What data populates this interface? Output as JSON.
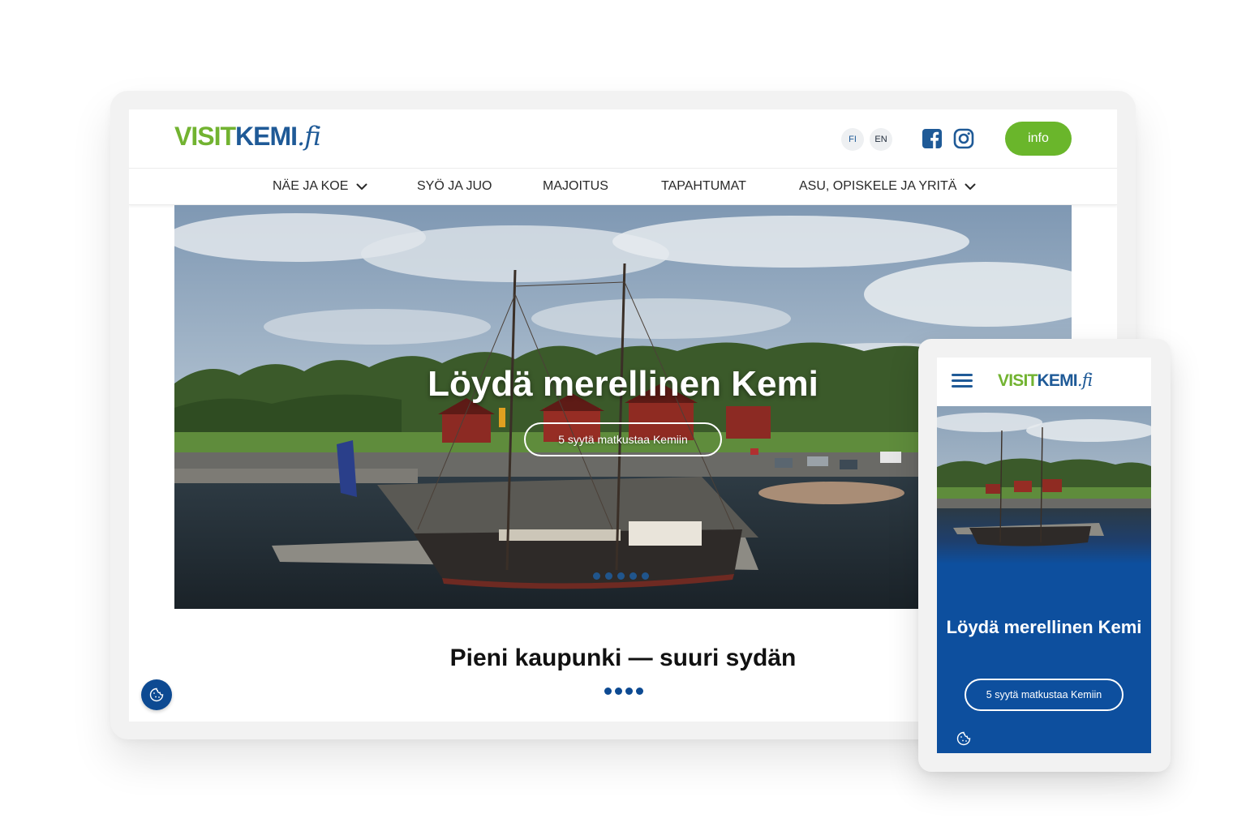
{
  "brand": {
    "logo_visit": "VISIT",
    "logo_kemi": "KEMI",
    "logo_tld": ".fi",
    "green": "#6ab62b",
    "blue": "#1f5a97",
    "dark_blue": "#0d4a92"
  },
  "header": {
    "lang_fi": "FI",
    "lang_en": "EN",
    "facebook_icon": "facebook-icon",
    "instagram_icon": "instagram-icon",
    "info_label": "info"
  },
  "nav": {
    "items": [
      {
        "label": "NÄE JA KOE",
        "has_dropdown": true
      },
      {
        "label": "SYÖ JA JUO",
        "has_dropdown": false
      },
      {
        "label": "MAJOITUS",
        "has_dropdown": false
      },
      {
        "label": "TAPAHTUMAT",
        "has_dropdown": false
      },
      {
        "label": "ASU, OPISKELE JA YRITÄ",
        "has_dropdown": true
      }
    ]
  },
  "hero": {
    "title": "Löydä merellinen Kemi",
    "cta_label": "5 syytä matkustaa Kemiin",
    "slide_count": 5
  },
  "section": {
    "title": "Pieni kaupunki — suuri sydän",
    "dot_count": 4
  },
  "mobile": {
    "menu_icon": "hamburger-menu-icon",
    "title": "Löydä merellinen Kemi",
    "cta_label": "5 syytä matkustaa Kemiin",
    "cookie_icon": "cookie-icon"
  }
}
